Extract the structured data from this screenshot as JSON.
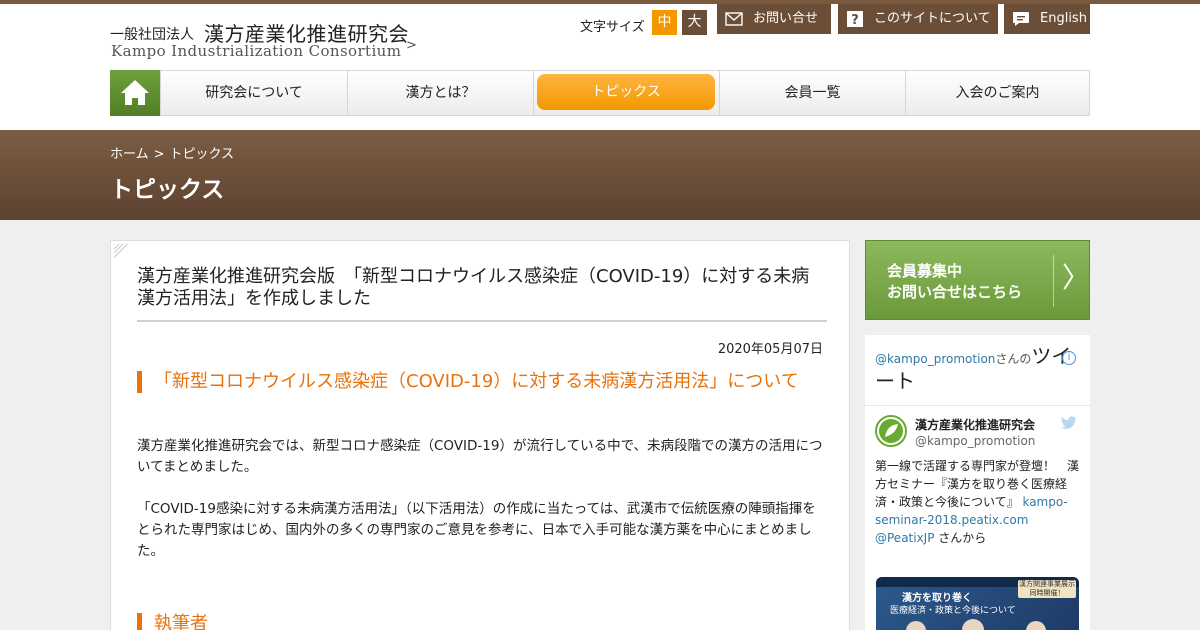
{
  "header": {
    "org_type": "一般社団法人",
    "org_name": "漢方産業化推進研究会",
    "org_name_en": "Kampo Industrialization Consortium",
    "org_arrow": ">",
    "font_size_label": "文字サイズ",
    "font_size_medium": "中",
    "font_size_large": "大",
    "contact_label": "お問い合せ",
    "about_site_label": "このサイトについて",
    "english_label": "English"
  },
  "nav": {
    "items": [
      {
        "label": "研究会について"
      },
      {
        "label": "漢方とは？"
      },
      {
        "label": "トピックス"
      },
      {
        "label": "会員一覧"
      },
      {
        "label": "入会のご案内"
      }
    ]
  },
  "banner": {
    "breadcrumb_home": "ホーム",
    "breadcrumb_sep": ">",
    "breadcrumb_current": "トピックス",
    "title": "トピックス"
  },
  "article": {
    "title": "漢方産業化推進研究会版　「新型コロナウイルス感染症（COVID-19）に対する未病漢方活用法」を作成しました",
    "date": "2020年05月07日",
    "section_heading": "「新型コロナウイルス感染症（COVID-19）に対する未病漢方活用法」について",
    "paragraph_1": "漢方産業化推進研究会では、新型コロナ感染症（COVID-19）が流行している中で、未病段階での漢方の活用についてまとめました。",
    "paragraph_2": "「COVID-19感染に対する未病漢方活用法」（以下活用法）の作成に当たっては、武漢市で伝統医療の陣頭指揮をとられた専門家はじめ、国内外の多くの専門家のご意見を参考に、日本で入手可能な漢方薬を中心にまとめました。",
    "section_heading_2": "執筆者"
  },
  "sidebar": {
    "banner_line1": "会員募集中",
    "banner_line2": "お問い合せはこちら",
    "banner_chevron": "〉",
    "twitter": {
      "handle_link": "@kampo_promotion",
      "handle_suffix": "さんの",
      "heading": "ツイート",
      "info_glyph": "i",
      "account_name": "漢方産業化推進研究会",
      "account_handle": "@kampo_promotion",
      "tweet_text": "第一線で活躍する専門家が登壇！　漢方セミナー『漢方を取り巻く医療経済・政策と今後について』 ",
      "tweet_link": "kampo-seminar-2018.peatix.com @PeatixJP",
      "tweet_suffix": " さんから",
      "image_title": "漢方を取り巻く",
      "image_subtitle": "医療経済・政策と今後について",
      "image_badge": "漢方関連事業展示同時開催！"
    }
  },
  "colors": {
    "brand_brown": "#6b4e37",
    "accent_orange": "#f39800",
    "heading_orange": "#e8720c",
    "home_green": "#5a8a2c",
    "link_blue": "#2f7aa6"
  }
}
